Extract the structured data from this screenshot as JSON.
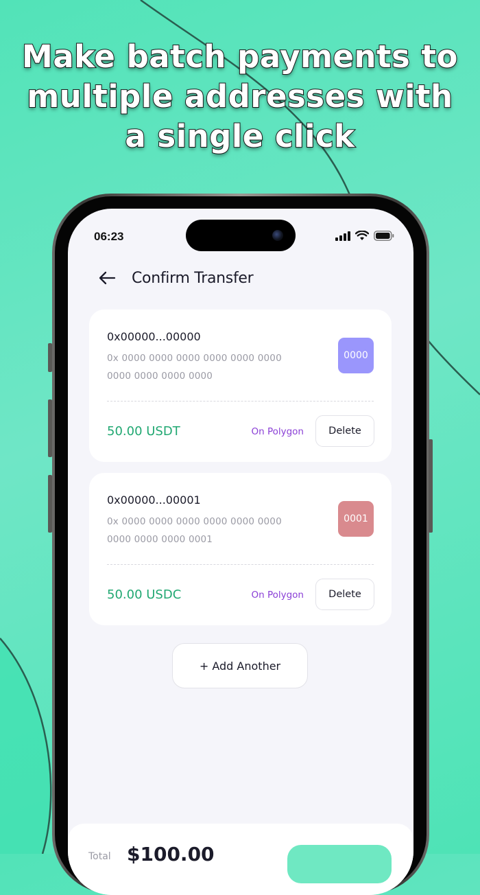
{
  "headline": {
    "line1": "Make batch payments to",
    "line2": "multiple addresses with",
    "line3": "a single click"
  },
  "status_bar": {
    "time": "06:23",
    "icons": [
      "signal-icon",
      "wifi-icon",
      "battery-icon"
    ]
  },
  "nav": {
    "back_icon": "arrow-left-icon",
    "title": "Confirm Transfer"
  },
  "transfers": [
    {
      "short_address": "0x00000...00000",
      "full_address_line1": "0x 0000 0000 0000 0000 0000 0000",
      "full_address_line2": "0000 0000 0000 0000",
      "badge": "0000",
      "badge_color": "#9a96fc",
      "amount": "50.00 USDT",
      "network": "On Polygon",
      "delete_label": "Delete"
    },
    {
      "short_address": "0x00000...00001",
      "full_address_line1": "0x 0000 0000 0000 0000 0000 0000",
      "full_address_line2": "0000 0000 0000 0001",
      "badge": "0001",
      "badge_color": "#d98a8e",
      "amount": "50.00 USDC",
      "network": "On Polygon",
      "delete_label": "Delete"
    }
  ],
  "add_button": {
    "label": "+ Add Another"
  },
  "footer": {
    "total_label": "Total",
    "total_value": "$100.00"
  },
  "colors": {
    "background_accent": "#52e3b8",
    "amount_green": "#21a872",
    "network_purple": "#8a3fd6",
    "confirm_button": "#6fe8c2"
  }
}
